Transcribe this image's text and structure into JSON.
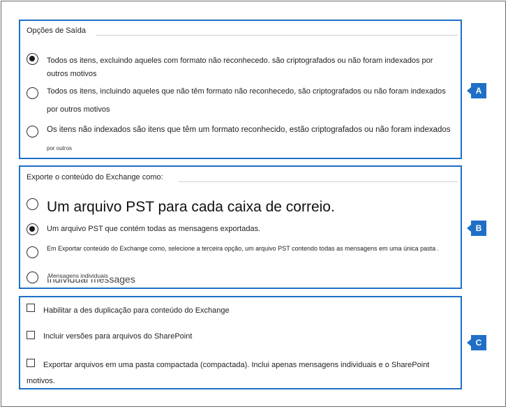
{
  "section_a": {
    "title": "Opções de Saída",
    "marker": "A",
    "options": [
      {
        "label": "Todos os itens, excluindo aqueles com formato não reconhecedo. são criptografados ou não foram indexados por",
        "label_cont": "outros motivos",
        "selected": true
      },
      {
        "label": "Todos os itens, incluindo aqueles que não têm formato não reconhecedo, são criptografados ou não foram indexados",
        "label_cont": "por outros motivos",
        "selected": false
      },
      {
        "label": "Os itens não indexados são itens que têm um formato reconhecido, estão criptografados ou não foram indexados",
        "label_cont": "por outros",
        "selected": false
      }
    ]
  },
  "section_b": {
    "title": "Exporte o conteúdo do Exchange como:",
    "marker": "B",
    "options": [
      {
        "label": "Um arquivo PST para cada caixa de correio.",
        "selected": false
      },
      {
        "label": "Um arquivo PST que contém todas as mensagens exportadas.",
        "selected": true
      },
      {
        "label": "Em Exportar conteúdo do Exchange como, selecione a terceira opção, um arquivo PST contendo todas as mensagens em uma única pasta .",
        "selected": false
      },
      {
        "label": "Mensagens individuais",
        "ghost_label": "Individual messages",
        "selected": false
      }
    ]
  },
  "section_c": {
    "marker": "C",
    "options": [
      {
        "label": "Habilitar a des duplicação para conteúdo do Exchange",
        "checked": false
      },
      {
        "label": "Incluir versões para arquivos do SharePoint",
        "checked": false
      },
      {
        "label": "Exportar arquivos em uma pasta compactada (compactada). Inclui apenas mensagens individuais e o SharePoint",
        "label_cont": "motivos.",
        "checked": false
      }
    ]
  }
}
